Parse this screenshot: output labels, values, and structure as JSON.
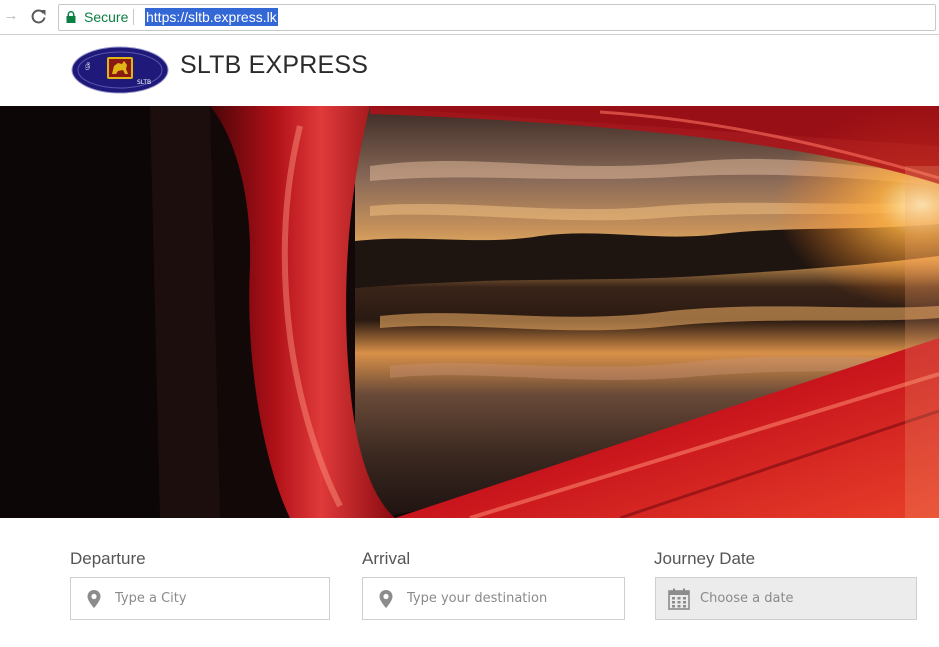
{
  "browser": {
    "secure_label": "Secure",
    "url": "https://sltb.express.lk"
  },
  "header": {
    "title": "SLTB EXPRESS",
    "logo_text": "SLTB"
  },
  "search": {
    "departure": {
      "label": "Departure",
      "placeholder": "Type a City"
    },
    "arrival": {
      "label": "Arrival",
      "placeholder": "Type your destination"
    },
    "journey_date": {
      "label": "Journey Date",
      "placeholder": "Choose a date"
    }
  },
  "colors": {
    "secure_green": "#0b8043",
    "url_highlight": "#3367d6",
    "bus_red": "#c8141c",
    "logo_navy": "#1f1a7a",
    "logo_gold": "#e2b514"
  }
}
